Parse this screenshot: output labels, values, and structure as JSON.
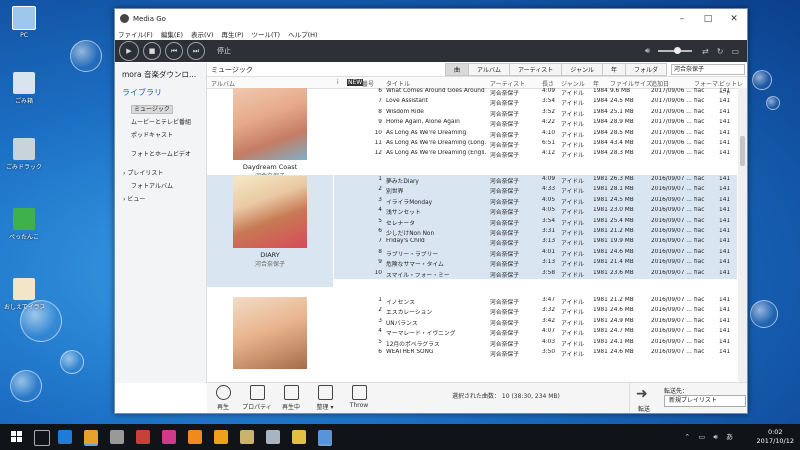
{
  "desktop": {
    "icons": [
      {
        "label": "PC"
      },
      {
        "label": "ごみ箱"
      },
      {
        "label": "ごみドラック"
      },
      {
        "label": "ぺったんこ"
      },
      {
        "label": "おしえてイラスト"
      }
    ]
  },
  "window": {
    "title": "Media Go",
    "menu": [
      "ファイル(F)",
      "編集(E)",
      "表示(V)",
      "再生(P)",
      "ツール(T)",
      "ヘルプ(H)"
    ],
    "status": "停止"
  },
  "sidebar": {
    "brand": "mora 音楽ダウンロ...",
    "library_label": "ライブラリ",
    "items": [
      {
        "label": "ミュージック",
        "selected": true
      },
      {
        "label": "ムービーとテレビ番組"
      },
      {
        "label": "ポッドキャスト"
      },
      {
        "label": "フォトとホームビデオ"
      },
      {
        "label": "プレイリスト"
      },
      {
        "label": "フォトアルバム"
      },
      {
        "label": "ビュー"
      }
    ]
  },
  "main": {
    "breadcrumb": "ミュージック",
    "tabs": [
      {
        "label": "曲",
        "active": true
      },
      {
        "label": "アルバム"
      },
      {
        "label": "アーティスト"
      },
      {
        "label": "ジャンル"
      },
      {
        "label": "年"
      },
      {
        "label": "フォルダ"
      }
    ],
    "search_value": "河合奈保子",
    "columns": [
      "アルバム",
      "i",
      "NEW",
      "番号",
      "タイトル",
      "アーティスト",
      "長さ",
      "ジャンル",
      "年",
      "ファイルサイズ",
      "追加日",
      "フォーマ...",
      "ビットレート"
    ],
    "groups": [
      {
        "album": "Daydream Coast",
        "artist": "河合奈保子",
        "selected": false,
        "rows": [
          [
            "6",
            "What Comes Around Goes Around",
            "河合奈保子",
            "4:09",
            "アイドル",
            "1984",
            "9.6 MB",
            "2017/09/06 ...",
            "flac",
            "141"
          ],
          [
            "7",
            "Love Assistant",
            "河合奈保子",
            "3:54",
            "アイドル",
            "1984",
            "24.5 MB",
            "2017/09/06 ...",
            "flac",
            "141"
          ],
          [
            "8",
            "Wisdom Ride",
            "河合奈保子",
            "3:52",
            "アイドル",
            "1984",
            "25.1 MB",
            "2017/09/06 ...",
            "flac",
            "141"
          ],
          [
            "9",
            "Home Again, Alone Again",
            "河合奈保子",
            "4:22",
            "アイドル",
            "1984",
            "28.9 MB",
            "2017/09/06 ...",
            "flac",
            "141"
          ],
          [
            "10",
            "As Long As We're Dreaming",
            "河合奈保子",
            "4:10",
            "アイドル",
            "1984",
            "28.5 MB",
            "2017/09/06 ...",
            "flac",
            "141"
          ],
          [
            "11",
            "As Long As We're Dreaming (Long...",
            "河合奈保子",
            "6:51",
            "アイドル",
            "1984",
            "43.4 MB",
            "2017/09/06 ...",
            "flac",
            "141"
          ],
          [
            "12",
            "As Long As We're Dreaming (Engli...",
            "河合奈保子",
            "4:12",
            "アイドル",
            "1984",
            "28.3 MB",
            "2017/09/06 ...",
            "flac",
            "141"
          ]
        ]
      },
      {
        "album": "DIARY",
        "artist": "河合奈保子",
        "selected": true,
        "rows": [
          [
            "1",
            "夢みたDiary",
            "河合奈保子",
            "4:09",
            "アイドル",
            "1981",
            "26.3 MB",
            "2016/09/07 ...",
            "flac",
            "141"
          ],
          [
            "2",
            "別世界",
            "河合奈保子",
            "4:33",
            "アイドル",
            "1981",
            "28.1 MB",
            "2016/09/07 ...",
            "flac",
            "141"
          ],
          [
            "3",
            "イライラMonday",
            "河合奈保子",
            "4:05",
            "アイドル",
            "1981",
            "24.5 MB",
            "2016/09/07 ...",
            "flac",
            "141"
          ],
          [
            "4",
            "浅サンセット",
            "河合奈保子",
            "4:05",
            "アイドル",
            "1981",
            "23.0 MB",
            "2016/09/07 ...",
            "flac",
            "141"
          ],
          [
            "5",
            "セレナータ",
            "河合奈保子",
            "3:54",
            "アイドル",
            "1981",
            "25.4 MB",
            "2016/09/07 ...",
            "flac",
            "141"
          ],
          [
            "6",
            "少しだけNon Non",
            "河合奈保子",
            "3:31",
            "アイドル",
            "1981",
            "21.2 MB",
            "2016/09/07 ...",
            "flac",
            "141"
          ],
          [
            "7",
            "Friday's Child",
            "河合奈保子",
            "3:13",
            "アイドル",
            "1981",
            "19.9 MB",
            "2016/09/07 ...",
            "flac",
            "141"
          ],
          [
            "8",
            "ラブリー・ラブリー",
            "河合奈保子",
            "4:01",
            "アイドル",
            "1981",
            "24.6 MB",
            "2016/09/07 ...",
            "flac",
            "141"
          ],
          [
            "9",
            "危険なサマー・タイム",
            "河合奈保子",
            "3:13",
            "アイドル",
            "1981",
            "21.4 MB",
            "2016/09/07 ...",
            "flac",
            "141"
          ],
          [
            "10",
            "スマイル・フォー・ミー",
            "河合奈保子",
            "3:58",
            "アイドル",
            "1981",
            "23.6 MB",
            "2016/09/07 ...",
            "flac",
            "141"
          ]
        ]
      },
      {
        "album": "",
        "artist": "",
        "selected": false,
        "rows": [
          [
            "1",
            "イノセンス",
            "河合奈保子",
            "3:47",
            "アイドル",
            "1981",
            "21.2 MB",
            "2016/09/07 ...",
            "flac",
            "141"
          ],
          [
            "2",
            "エスカレーション",
            "河合奈保子",
            "3:32",
            "アイドル",
            "1981",
            "24.6 MB",
            "2016/09/07 ...",
            "flac",
            "141"
          ],
          [
            "3",
            "UNバランス",
            "河合奈保子",
            "3:42",
            "アイドル",
            "1981",
            "24.9 MB",
            "2016/09/07 ...",
            "flac",
            "141"
          ],
          [
            "4",
            "マーマレード・イヴニング",
            "河合奈保子",
            "4:07",
            "アイドル",
            "1981",
            "24.7 MB",
            "2016/09/07 ...",
            "flac",
            "141"
          ],
          [
            "5",
            "12月のポペラグラス",
            "河合奈保子",
            "4:03",
            "アイドル",
            "1981",
            "24.1 MB",
            "2016/09/07 ...",
            "flac",
            "141"
          ],
          [
            "6",
            "WEATHER SONG",
            "河合奈保子",
            "3:50",
            "アイドル",
            "1981",
            "24.6 MB",
            "2016/09/07 ...",
            "flac",
            "141"
          ]
        ]
      }
    ]
  },
  "toolbar": {
    "buttons": [
      "再生",
      "プロパティ",
      "再生中",
      "整理 ▾",
      "Throw"
    ],
    "selection_info": "選択された曲数： 10 (38:30, 234 MB)",
    "transfer_label": "転送",
    "dest_label": "転送先：",
    "dest_value": "新規プレイリスト"
  },
  "taskbar": {
    "time": "0:02",
    "date": "2017/10/12",
    "ime": "あ"
  }
}
